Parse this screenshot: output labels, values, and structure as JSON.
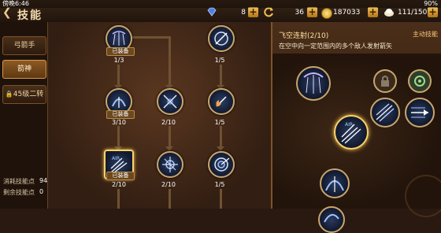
{
  "status": {
    "time": "傍晚6:46",
    "battery": "90%"
  },
  "header": {
    "title": "技能",
    "back_icon": "back-arrow-icon"
  },
  "resources": [
    {
      "name": "gem",
      "icon": "blue-gem-icon",
      "value": "8"
    },
    {
      "name": "energy",
      "icon": "refresh-icon",
      "value": "36"
    },
    {
      "name": "gold",
      "icon": "gold-coin-icon",
      "value": "187033"
    },
    {
      "name": "stamina",
      "icon": "stamina-icon",
      "value": "111/150"
    }
  ],
  "sidebar": {
    "tabs": [
      {
        "label": "弓箭手",
        "active": false
      },
      {
        "label": "箭神",
        "active": true
      },
      {
        "label": "45级二转",
        "active": false,
        "icon": "lock-icon"
      }
    ],
    "stats": [
      {
        "label": "消耗技能点",
        "value": "94"
      },
      {
        "label": "剩余技能点",
        "value": "0"
      }
    ]
  },
  "tree": {
    "equipped_label": "已装备",
    "nodes": [
      {
        "id": "n1",
        "level": "1/3",
        "equipped": true,
        "icon": "arrow-rain-icon"
      },
      {
        "id": "n2",
        "level": "1/5",
        "equipped": false,
        "icon": "target-arrow-icon"
      },
      {
        "id": "n3",
        "level": "3/10",
        "equipped": true,
        "icon": "arc-arrows-icon"
      },
      {
        "id": "n4",
        "level": "2/10",
        "equipped": false,
        "icon": "crossed-arrows-icon"
      },
      {
        "id": "n5",
        "level": "1/5",
        "equipped": false,
        "icon": "flaming-arrow-icon"
      },
      {
        "id": "n6",
        "level": "2/10",
        "equipped": true,
        "selected": true,
        "icon": "sky-shot-icon",
        "badge": "AIR"
      },
      {
        "id": "n7",
        "level": "2/10",
        "equipped": false,
        "icon": "burst-arrow-icon"
      },
      {
        "id": "n8",
        "level": "1/5",
        "equipped": false,
        "icon": "spiral-arrow-icon"
      }
    ]
  },
  "detail": {
    "title": "飞空连射(2/10)",
    "type": "主动技能",
    "description": "在空中向一定范围内的多个敌人发射箭矢",
    "slot_icons": [
      "arrow-rain-icon",
      "lock-icon",
      "gear-icon",
      "multi-arrow-icon",
      "piercing-arrow-icon",
      "sky-shot-icon",
      "arc-arrows-icon",
      "swirl-arrow-icon"
    ]
  },
  "colors": {
    "accent": "#ffd36a",
    "panel": "#2c1a0e",
    "plus_button": "#f3c25a"
  }
}
